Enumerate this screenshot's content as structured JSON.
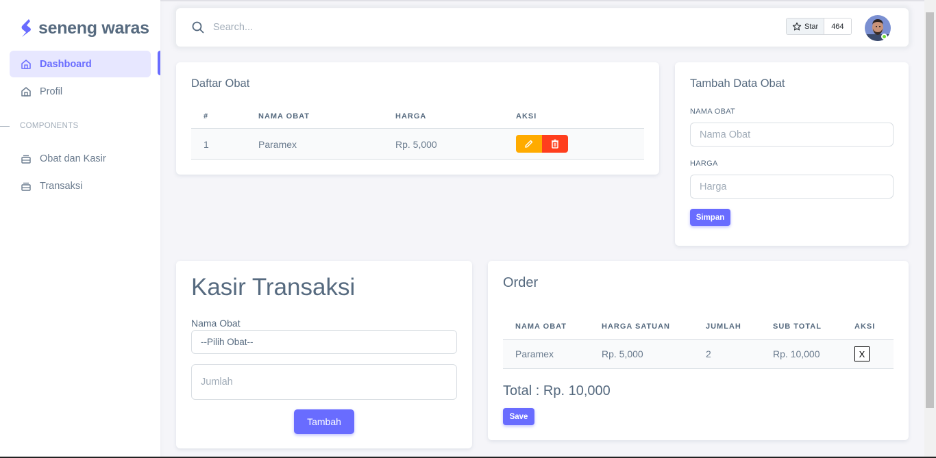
{
  "brand": {
    "name": "seneng waras",
    "color": "#696cff"
  },
  "sidebar": {
    "items": [
      {
        "label": "Dashboard",
        "icon": "home-icon",
        "active": true
      },
      {
        "label": "Profil",
        "icon": "home-icon",
        "active": false
      }
    ],
    "section_header": "COMPONENTS",
    "components": [
      {
        "label": "Obat dan Kasir",
        "icon": "layers-icon"
      },
      {
        "label": "Transaksi",
        "icon": "layers-icon"
      }
    ]
  },
  "navbar": {
    "search_placeholder": "Search...",
    "github": {
      "star_label": "Star",
      "count": "464"
    },
    "avatar": "user-avatar",
    "status": "online"
  },
  "daftar_obat": {
    "title": "Daftar Obat",
    "columns": [
      "#",
      "NAMA OBAT",
      "HARGA",
      "AKSI"
    ],
    "rows": [
      {
        "no": "1",
        "nama": "Paramex",
        "harga": "Rp. 5,000"
      }
    ]
  },
  "tambah_obat": {
    "title": "Tambah Data Obat",
    "nama_label": "NAMA OBAT",
    "nama_placeholder": "Nama Obat",
    "harga_label": "HARGA",
    "harga_placeholder": "Harga",
    "submit_label": "Simpan"
  },
  "kasir": {
    "title": "Kasir Transaksi",
    "nama_label": "Nama Obat",
    "select_value": "--Pilih Obat--",
    "jumlah_placeholder": "Jumlah",
    "submit_label": "Tambah"
  },
  "order": {
    "title": "Order",
    "columns": [
      "NAMA OBAT",
      "HARGA SATUAN",
      "JUMLAH",
      "SUB TOTAL",
      "AKSI"
    ],
    "rows": [
      {
        "nama": "Paramex",
        "harga": "Rp. 5,000",
        "jumlah": "2",
        "subtotal": "Rp. 10,000",
        "aksi": "X"
      }
    ],
    "total": "Total : Rp. 10,000",
    "save_label": "Save"
  },
  "colors": {
    "primary": "#696cff",
    "warning": "#ffab00",
    "danger": "#ff3e1d",
    "text": "#566a7f",
    "background": "#f5f5f9"
  }
}
